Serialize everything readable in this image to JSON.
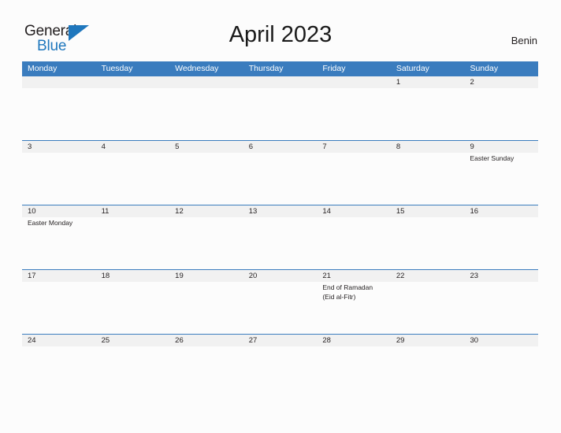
{
  "brand": {
    "word_one": "General",
    "word_two": "Blue",
    "triangle_icon": "triangle-right-icon",
    "accent_color": "#1f77bd"
  },
  "header": {
    "title": "April 2023",
    "country": "Benin"
  },
  "calendar": {
    "header_color": "#3a7cbe",
    "band_color": "#f1f1f1",
    "weekdays": [
      "Monday",
      "Tuesday",
      "Wednesday",
      "Thursday",
      "Friday",
      "Saturday",
      "Sunday"
    ],
    "weeks": [
      {
        "days": [
          {
            "num": "",
            "event": ""
          },
          {
            "num": "",
            "event": ""
          },
          {
            "num": "",
            "event": ""
          },
          {
            "num": "",
            "event": ""
          },
          {
            "num": "",
            "event": ""
          },
          {
            "num": "1",
            "event": ""
          },
          {
            "num": "2",
            "event": ""
          }
        ]
      },
      {
        "days": [
          {
            "num": "3",
            "event": ""
          },
          {
            "num": "4",
            "event": ""
          },
          {
            "num": "5",
            "event": ""
          },
          {
            "num": "6",
            "event": ""
          },
          {
            "num": "7",
            "event": ""
          },
          {
            "num": "8",
            "event": ""
          },
          {
            "num": "9",
            "event": "Easter Sunday"
          }
        ]
      },
      {
        "days": [
          {
            "num": "10",
            "event": "Easter Monday"
          },
          {
            "num": "11",
            "event": ""
          },
          {
            "num": "12",
            "event": ""
          },
          {
            "num": "13",
            "event": ""
          },
          {
            "num": "14",
            "event": ""
          },
          {
            "num": "15",
            "event": ""
          },
          {
            "num": "16",
            "event": ""
          }
        ]
      },
      {
        "days": [
          {
            "num": "17",
            "event": ""
          },
          {
            "num": "18",
            "event": ""
          },
          {
            "num": "19",
            "event": ""
          },
          {
            "num": "20",
            "event": ""
          },
          {
            "num": "21",
            "event": "End of Ramadan\n(Eid al-Fitr)"
          },
          {
            "num": "22",
            "event": ""
          },
          {
            "num": "23",
            "event": ""
          }
        ]
      },
      {
        "days": [
          {
            "num": "24",
            "event": ""
          },
          {
            "num": "25",
            "event": ""
          },
          {
            "num": "26",
            "event": ""
          },
          {
            "num": "27",
            "event": ""
          },
          {
            "num": "28",
            "event": ""
          },
          {
            "num": "29",
            "event": ""
          },
          {
            "num": "30",
            "event": ""
          }
        ]
      }
    ]
  }
}
